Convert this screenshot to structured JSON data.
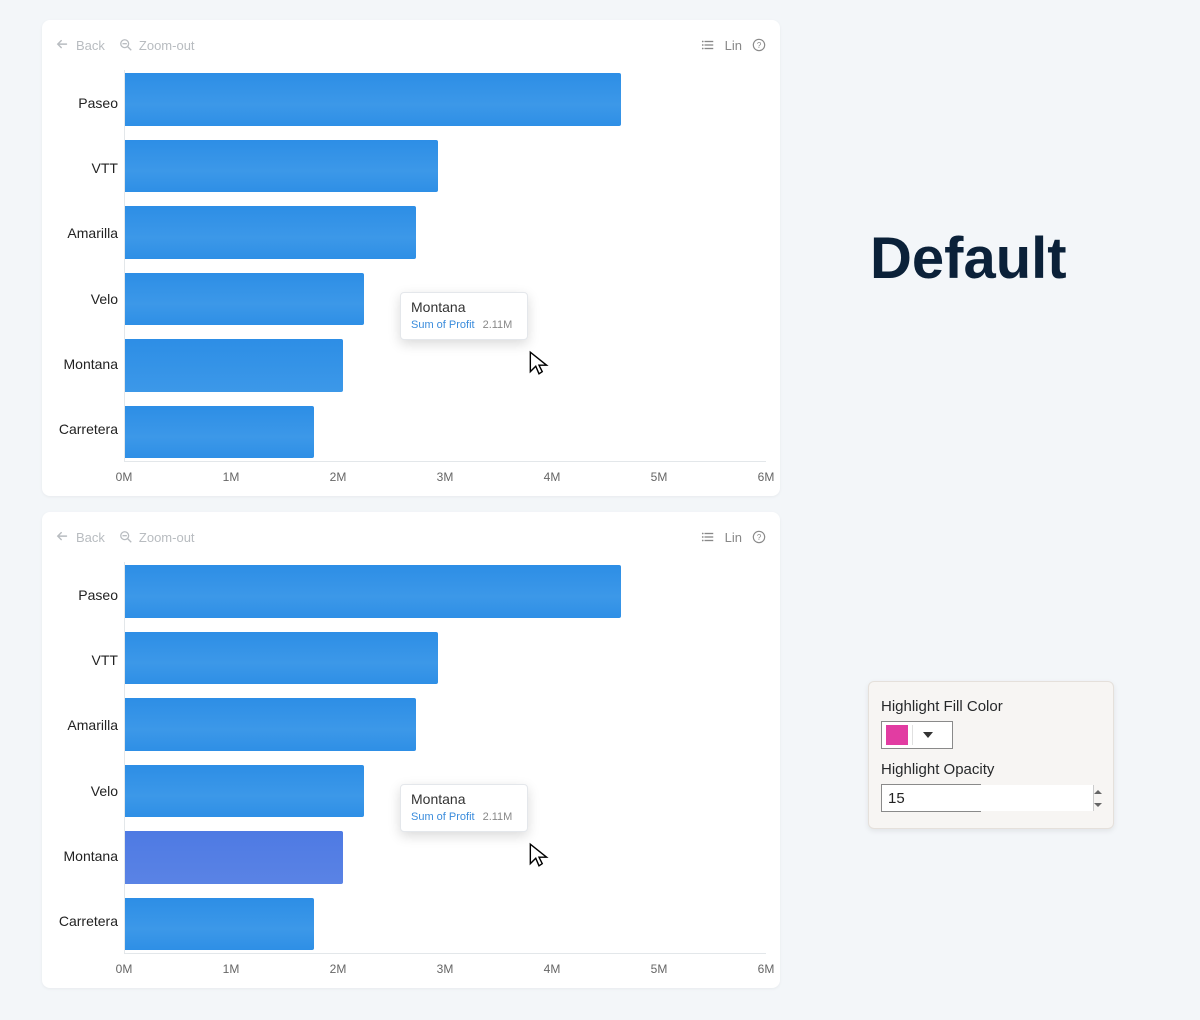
{
  "toolbar": {
    "back": "Back",
    "zoom_out": "Zoom-out",
    "scale": "Lin"
  },
  "side_label": "Default",
  "tooltip": {
    "title": "Montana",
    "metric_label": "Sum of Profit",
    "metric_value": "2.11M"
  },
  "settings": {
    "fill_label": "Highlight Fill Color",
    "fill_color": "#e23ca2",
    "opacity_label": "Highlight Opacity",
    "opacity_value": "15"
  },
  "chart_data": [
    {
      "id": "top",
      "type": "bar",
      "orientation": "horizontal",
      "xlabel": "",
      "ylabel": "",
      "x_ticks": [
        "0M",
        "1M",
        "2M",
        "3M",
        "4M",
        "5M",
        "6M"
      ],
      "xlim": [
        0,
        6.2
      ],
      "categories": [
        "Paseo",
        "VTT",
        "Amarilla",
        "Velo",
        "Montana",
        "Carretera"
      ],
      "values": [
        4.8,
        3.03,
        2.81,
        2.31,
        2.11,
        1.83
      ],
      "highlighted_category": "Montana",
      "highlight_style": "default"
    },
    {
      "id": "bottom",
      "type": "bar",
      "orientation": "horizontal",
      "xlabel": "",
      "ylabel": "",
      "x_ticks": [
        "0M",
        "1M",
        "2M",
        "3M",
        "4M",
        "5M",
        "6M"
      ],
      "xlim": [
        0,
        6.2
      ],
      "categories": [
        "Paseo",
        "VTT",
        "Amarilla",
        "Velo",
        "Montana",
        "Carretera"
      ],
      "values": [
        4.8,
        3.03,
        2.81,
        2.31,
        2.11,
        1.83
      ],
      "highlighted_category": "Montana",
      "highlight_style": "custom"
    }
  ]
}
